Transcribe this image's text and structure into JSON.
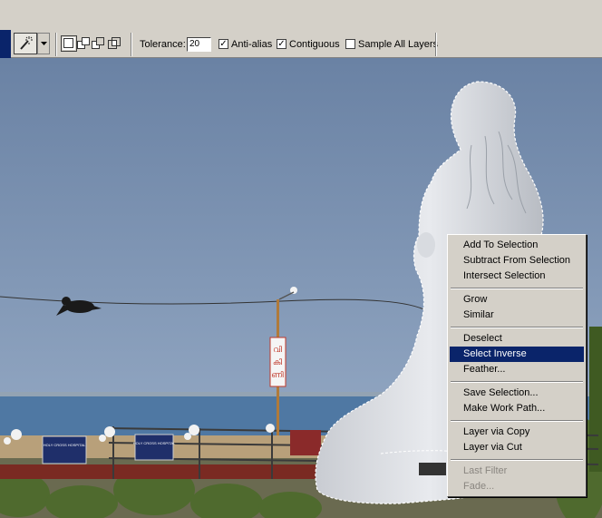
{
  "options_bar": {
    "tool_icon": "magic-wand-icon",
    "selection_modes": [
      "new-selection-icon",
      "add-to-selection-icon",
      "subtract-from-selection-icon",
      "intersect-selection-icon"
    ],
    "tolerance_label": "Tolerance:",
    "tolerance_value": "20",
    "antialias": {
      "label": "Anti-alias",
      "checked": true
    },
    "contiguous": {
      "label": "Contiguous",
      "checked": true
    },
    "sample_all_layers": {
      "label": "Sample All Layers",
      "checked": false
    }
  },
  "canvas": {
    "sign_text": "വി\nകി\nണി",
    "board_left_text": "HOLY CROSS HOSPITAL",
    "board_right_text": "HOLY CROSS HOSPITAL"
  },
  "context_menu": {
    "groups": [
      [
        {
          "label": "Add To Selection",
          "enabled": true
        },
        {
          "label": "Subtract From Selection",
          "enabled": true
        },
        {
          "label": "Intersect Selection",
          "enabled": true
        }
      ],
      [
        {
          "label": "Grow",
          "enabled": true
        },
        {
          "label": "Similar",
          "enabled": true
        }
      ],
      [
        {
          "label": "Deselect",
          "enabled": true
        },
        {
          "label": "Select Inverse",
          "enabled": true,
          "highlighted": true
        },
        {
          "label": "Feather...",
          "enabled": true
        }
      ],
      [
        {
          "label": "Save Selection...",
          "enabled": true
        },
        {
          "label": "Make Work Path...",
          "enabled": true
        }
      ],
      [
        {
          "label": "Layer via Copy",
          "enabled": true
        },
        {
          "label": "Layer via Cut",
          "enabled": true
        }
      ],
      [
        {
          "label": "Last Filter",
          "enabled": false
        },
        {
          "label": "Fade...",
          "enabled": false
        }
      ]
    ]
  },
  "colors": {
    "menu_highlight": "#0a246a",
    "menu_bg": "#d4d0c8",
    "sky": "#6f87a8",
    "sea": "#5a7ea6"
  }
}
